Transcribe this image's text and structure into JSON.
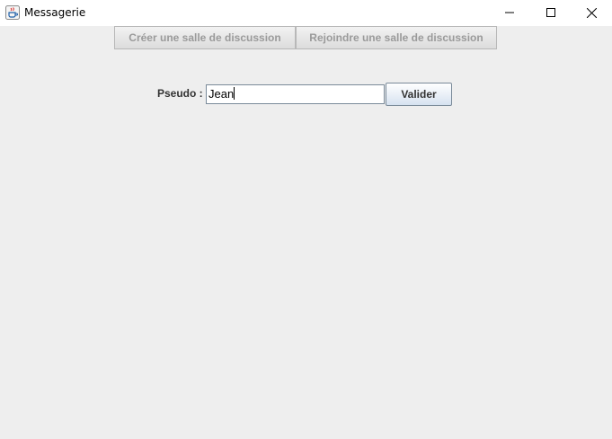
{
  "window": {
    "title": "Messagerie",
    "icon": "java-cup-icon"
  },
  "toolbar": {
    "create_room_label": "Créer une salle de discussion",
    "join_room_label": "Rejoindre une salle de discussion"
  },
  "form": {
    "pseudo_label": "Pseudo :",
    "pseudo_value": "Jean",
    "submit_label": "Valider"
  }
}
